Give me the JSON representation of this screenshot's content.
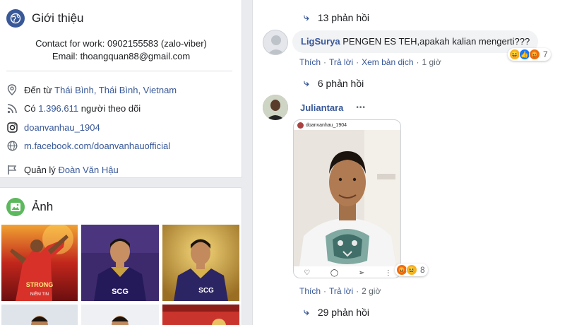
{
  "intro": {
    "title": "Giới thiệu",
    "bio_line1": "Contact for work: 0902155583 (zalo-viber)",
    "bio_line2": "Email: thoangquan88@gmail.com",
    "from_prefix": "Đến từ",
    "from_place": "Thái Bình, Thái Bình, Vietnam",
    "followers_prefix": "Có",
    "followers_count": "1.396.611",
    "followers_suffix": "người theo dõi",
    "instagram": "doanvanhau_1904",
    "website": "m.facebook.com/doanvanhauofficial",
    "manager_prefix": "Quản lý",
    "manager_name": "Đoàn Văn Hậu"
  },
  "photos": {
    "title": "Ảnh",
    "caption_strong": "STRONG",
    "caption_sub": "NIỀM TIN"
  },
  "comments": {
    "replies_top": "13 phản hồi",
    "c1": {
      "author": "LigSurya",
      "text": "PENGEN ES TEH,apakah kalian mengerti???",
      "like": "Thích",
      "reply": "Trả lời",
      "translate": "Xem bản dịch",
      "time": "1 giờ",
      "reaction_count": "7",
      "replies": "6 phản hồi"
    },
    "c2": {
      "author": "Juliantara",
      "more": "•••",
      "ig_user": "doanvanhau_1904",
      "like": "Thích",
      "reply": "Trả lời",
      "time": "2 giờ",
      "reaction_count": "8",
      "replies": "29 phản hồi"
    },
    "dot": "·"
  },
  "colors": {
    "link": "#385898",
    "background": "#e9ebee",
    "bubble": "#f2f3f5"
  }
}
